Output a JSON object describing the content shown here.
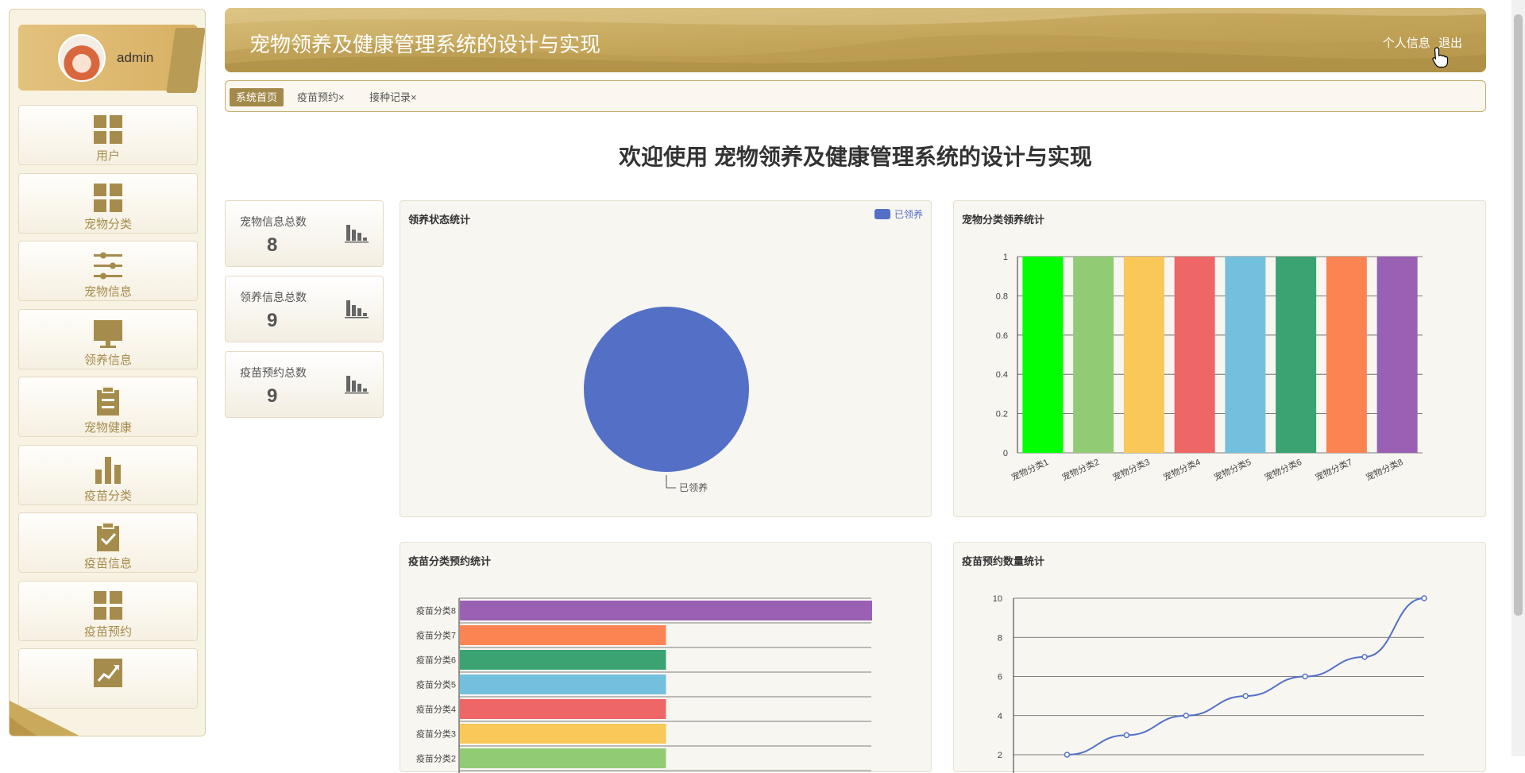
{
  "header": {
    "title": "宠物领养及健康管理系统的设计与实现",
    "profile_link": "个人信息",
    "logout_link": "退出"
  },
  "user": {
    "name": "admin"
  },
  "sidebar": {
    "items": [
      {
        "label": "用户",
        "icon": "grid-icon"
      },
      {
        "label": "宠物分类",
        "icon": "grid-icon"
      },
      {
        "label": "宠物信息",
        "icon": "sliders-icon"
      },
      {
        "label": "领养信息",
        "icon": "monitor-icon"
      },
      {
        "label": "宠物健康",
        "icon": "clipboard-icon"
      },
      {
        "label": "疫苗分类",
        "icon": "bar-chart-icon"
      },
      {
        "label": "疫苗信息",
        "icon": "clipboard-check-icon"
      },
      {
        "label": "疫苗预约",
        "icon": "grid-icon"
      },
      {
        "label": "",
        "icon": "trend-chart-icon"
      }
    ]
  },
  "tabs": [
    {
      "label": "系统首页",
      "active": true
    },
    {
      "label": "疫苗预约",
      "close": "×"
    },
    {
      "label": "接种记录",
      "close": "×"
    }
  ],
  "welcome": "欢迎使用 宠物领养及健康管理系统的设计与实现",
  "stats": [
    {
      "label": "宠物信息总数",
      "value": "8"
    },
    {
      "label": "领养信息总数",
      "value": "9"
    },
    {
      "label": "疫苗预约总数",
      "value": "9"
    }
  ],
  "colors": {
    "gold": "#c5a95c",
    "accent": "#a38a4b",
    "pie": "#5470c6"
  },
  "chart_data": [
    {
      "type": "pie",
      "title": "领养状态统计",
      "legend": [
        "已领养"
      ],
      "legend_position": "top-right",
      "slices": [
        {
          "label": "已领养",
          "value": 1,
          "color": "#5470c6"
        }
      ]
    },
    {
      "type": "bar",
      "title": "宠物分类领养统计",
      "categories": [
        "宠物分类1",
        "宠物分类2",
        "宠物分类3",
        "宠物分类4",
        "宠物分类5",
        "宠物分类6",
        "宠物分类7",
        "宠物分类8"
      ],
      "values": [
        1,
        1,
        1,
        1,
        1,
        1,
        1,
        1
      ],
      "colors": [
        "#00ff00",
        "#91cc75",
        "#fac858",
        "#ee6666",
        "#73c0de",
        "#3ba272",
        "#fc8452",
        "#9a60b4"
      ],
      "yticks": [
        "0",
        "0.2",
        "0.4",
        "0.6",
        "0.8",
        "1"
      ],
      "ylim": [
        0,
        1
      ],
      "grid": true
    },
    {
      "type": "bar",
      "orientation": "horizontal",
      "title": "疫苗分类预约统计",
      "categories": [
        "疫苗分类8",
        "疫苗分类7",
        "疫苗分类6",
        "疫苗分类5",
        "疫苗分类4",
        "疫苗分类3",
        "疫苗分类2"
      ],
      "values": [
        2,
        1,
        1,
        1,
        1,
        1,
        1
      ],
      "colors": [
        "#9a60b4",
        "#fc8452",
        "#3ba272",
        "#73c0de",
        "#ee6666",
        "#fac858",
        "#91cc75"
      ],
      "xlim": [
        0,
        2
      ]
    },
    {
      "type": "line",
      "title": "疫苗预约数量统计",
      "values": [
        2,
        3,
        4,
        5,
        6,
        7,
        10
      ],
      "yticks": [
        "2",
        "4",
        "6",
        "8",
        "10"
      ],
      "ylim": [
        2,
        10
      ],
      "grid": true
    }
  ]
}
